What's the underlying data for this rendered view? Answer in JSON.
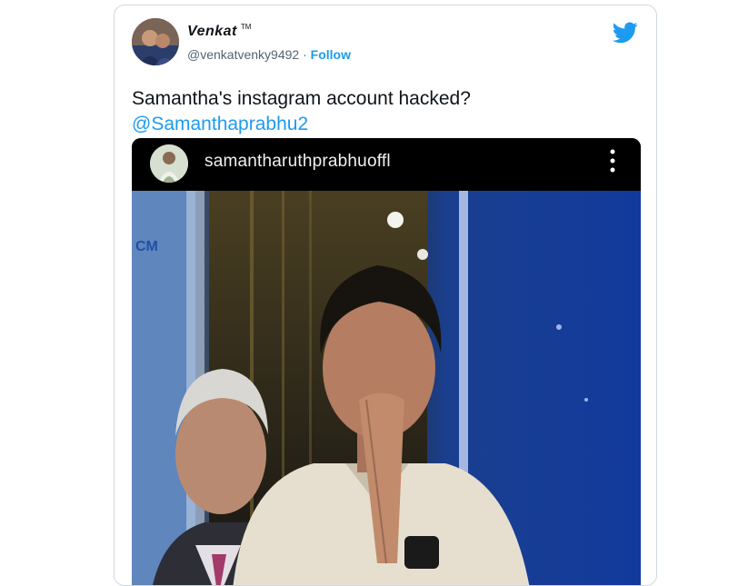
{
  "tweet": {
    "display_name": "Venkat",
    "name_badge": "TM",
    "handle": "@venkatvenky9492",
    "separator": "·",
    "follow_label": "Follow",
    "text": "Samantha's instagram account hacked?",
    "mention": "@Samanthaprabhu2",
    "brand_icon": "twitter-bird-icon"
  },
  "embed": {
    "username": "samantharuthprabhuoffl",
    "more_icon": "vertical-ellipsis-icon",
    "photo_banner_text": "CM"
  },
  "colors": {
    "accent": "#1d9bf0",
    "text": "#0f1419",
    "muted": "#536471",
    "border": "#cfd9de"
  }
}
